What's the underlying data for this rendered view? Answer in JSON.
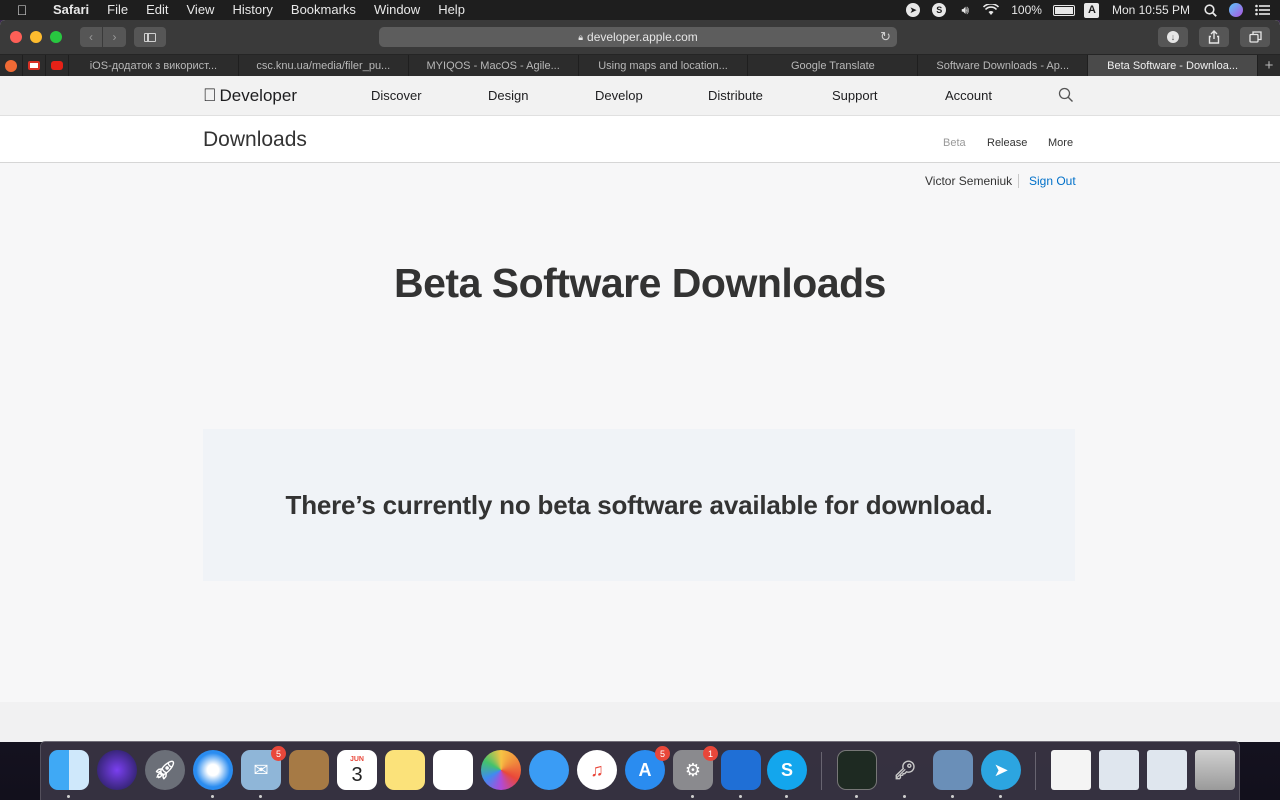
{
  "menubar": {
    "app_name": "Safari",
    "items": [
      "File",
      "Edit",
      "View",
      "History",
      "Bookmarks",
      "Window",
      "Help"
    ],
    "battery_percent": "100%",
    "clock": "Mon 10:55 PM",
    "input_source": "A"
  },
  "browser": {
    "url": "developer.apple.com",
    "tabs": [
      "iOS-додаток з використ...",
      "csc.knu.ua/media/filer_pu...",
      "MYIQOS - MacOS - Agile...",
      "Using maps and location...",
      "Google Translate",
      "Software Downloads - Ap...",
      "Beta Software - Downloa..."
    ],
    "active_tab_index": 6
  },
  "globalnav": {
    "brand": "Developer",
    "links": [
      "Discover",
      "Design",
      "Develop",
      "Distribute",
      "Support",
      "Account"
    ]
  },
  "localnav": {
    "title": "Downloads",
    "links": [
      "Beta",
      "Release",
      "More"
    ],
    "current": "Beta"
  },
  "account": {
    "user_name": "Victor Semeniuk",
    "sign_out_label": "Sign Out"
  },
  "main": {
    "heading": "Beta Software Downloads",
    "notice": "There’s currently no beta software available for download."
  },
  "dock": {
    "badges": {
      "mail": "5",
      "app_store": "5",
      "system_preferences": "1"
    },
    "calendar_month": "JUN",
    "calendar_day": "3"
  },
  "colors": {
    "link_blue": "#0070c9",
    "notice_bg": "#f0f3f7",
    "page_bg": "#f7f7f8"
  }
}
